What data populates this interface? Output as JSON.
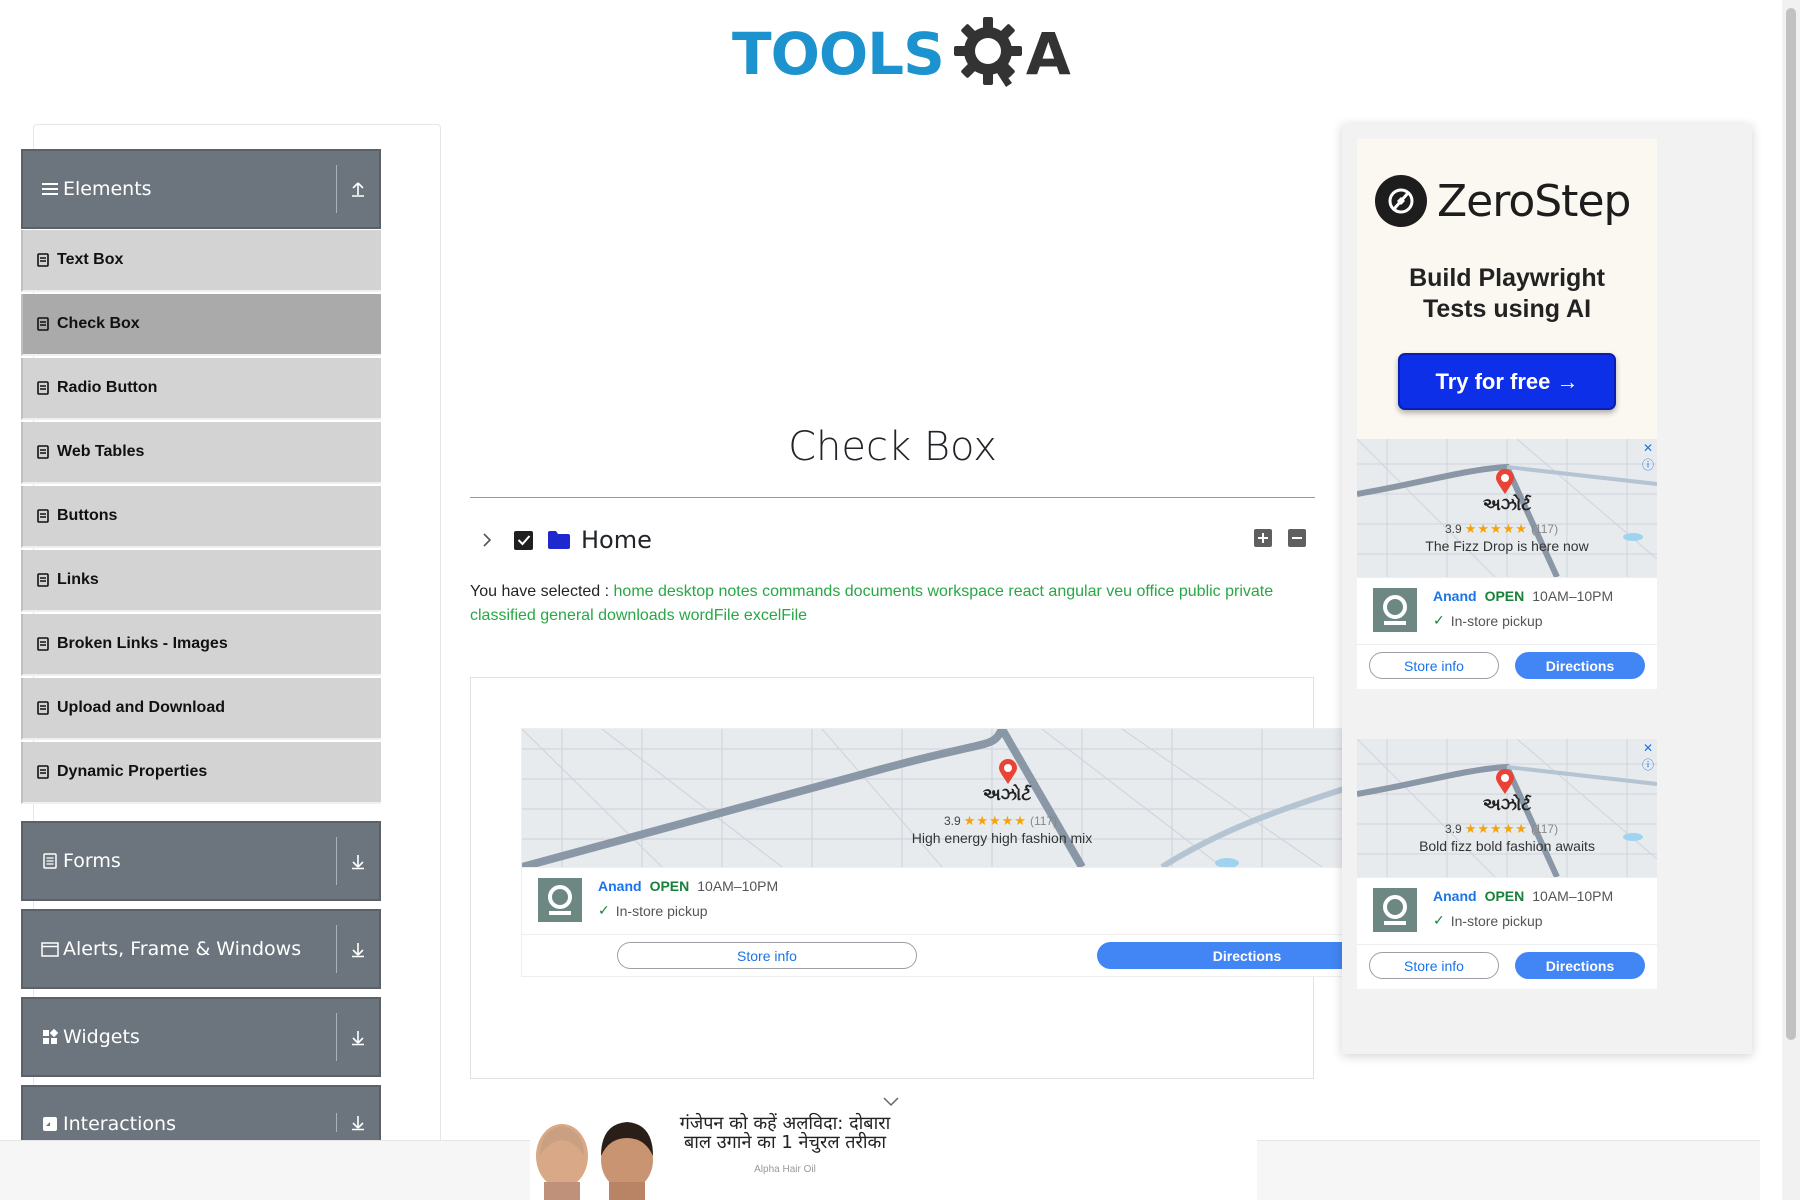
{
  "logo": {
    "tools": "TOOLS",
    "a": "A"
  },
  "sidebar": {
    "elements": {
      "title": "Elements",
      "items": [
        {
          "label": "Text Box"
        },
        {
          "label": "Check Box",
          "active": true
        },
        {
          "label": "Radio Button"
        },
        {
          "label": "Web Tables"
        },
        {
          "label": "Buttons"
        },
        {
          "label": "Links"
        },
        {
          "label": "Broken Links - Images"
        },
        {
          "label": "Upload and Download"
        },
        {
          "label": "Dynamic Properties"
        }
      ]
    },
    "groups": [
      {
        "title": "Forms"
      },
      {
        "title": "Alerts, Frame & Windows"
      },
      {
        "title": "Widgets"
      },
      {
        "title": "Interactions"
      }
    ]
  },
  "main": {
    "title": "Check Box",
    "tree": {
      "root_label": "Home",
      "root_checked": true,
      "expanded": false
    },
    "selected": {
      "prefix": "You have selected :",
      "items": "home desktop notes commands documents workspace react angular veu office public private classified general downloads wordFile excelFile"
    }
  },
  "map_ads": [
    {
      "place": "અઝોર્ટ",
      "rating": "3.9",
      "stars": "★★★★★",
      "count": "(117)",
      "caption": "High energy high fashion mix",
      "store": "Anand",
      "status": "OPEN",
      "hours": "10AM–10PM",
      "pickup": "In-store pickup",
      "store_info": "Store info",
      "directions": "Directions"
    },
    {
      "place": "અઝોર્ટ",
      "rating": "3.9",
      "stars": "★★★★★",
      "count": "(117)",
      "caption": "The Fizz Drop is here now",
      "store": "Anand",
      "status": "OPEN",
      "hours": "10AM–10PM",
      "pickup": "In-store pickup",
      "store_info": "Store info",
      "directions": "Directions"
    },
    {
      "place": "અઝોર્ટ",
      "rating": "3.9",
      "stars": "★★★★★",
      "count": "(117)",
      "caption": "Bold fizz bold fashion awaits",
      "store": "Anand",
      "status": "OPEN",
      "hours": "10AM–10PM",
      "pickup": "In-store pickup",
      "store_info": "Store info",
      "directions": "Directions"
    }
  ],
  "zerostep_ad": {
    "brand": "ZeroStep",
    "headline_1": "Build Playwright",
    "headline_2": "Tests using AI",
    "cta": "Try for free →"
  },
  "bottom_ad": {
    "line1": "गंजेपन को कहें अलविदा: दोबारा",
    "line2": "बाल उगाने का 1 नेचुरल तरीका",
    "brand": "Alpha Hair Oil"
  },
  "colors": {
    "brand_blue": "#1c93cf",
    "sidebar_header": "#6c757d",
    "menu_item": "#d3d3d3",
    "menu_item_active": "#aaaaaa",
    "selected_highlight": "#28a745",
    "directions_blue": "#4285f4",
    "zerostep_cta": "#0d2fe8"
  }
}
